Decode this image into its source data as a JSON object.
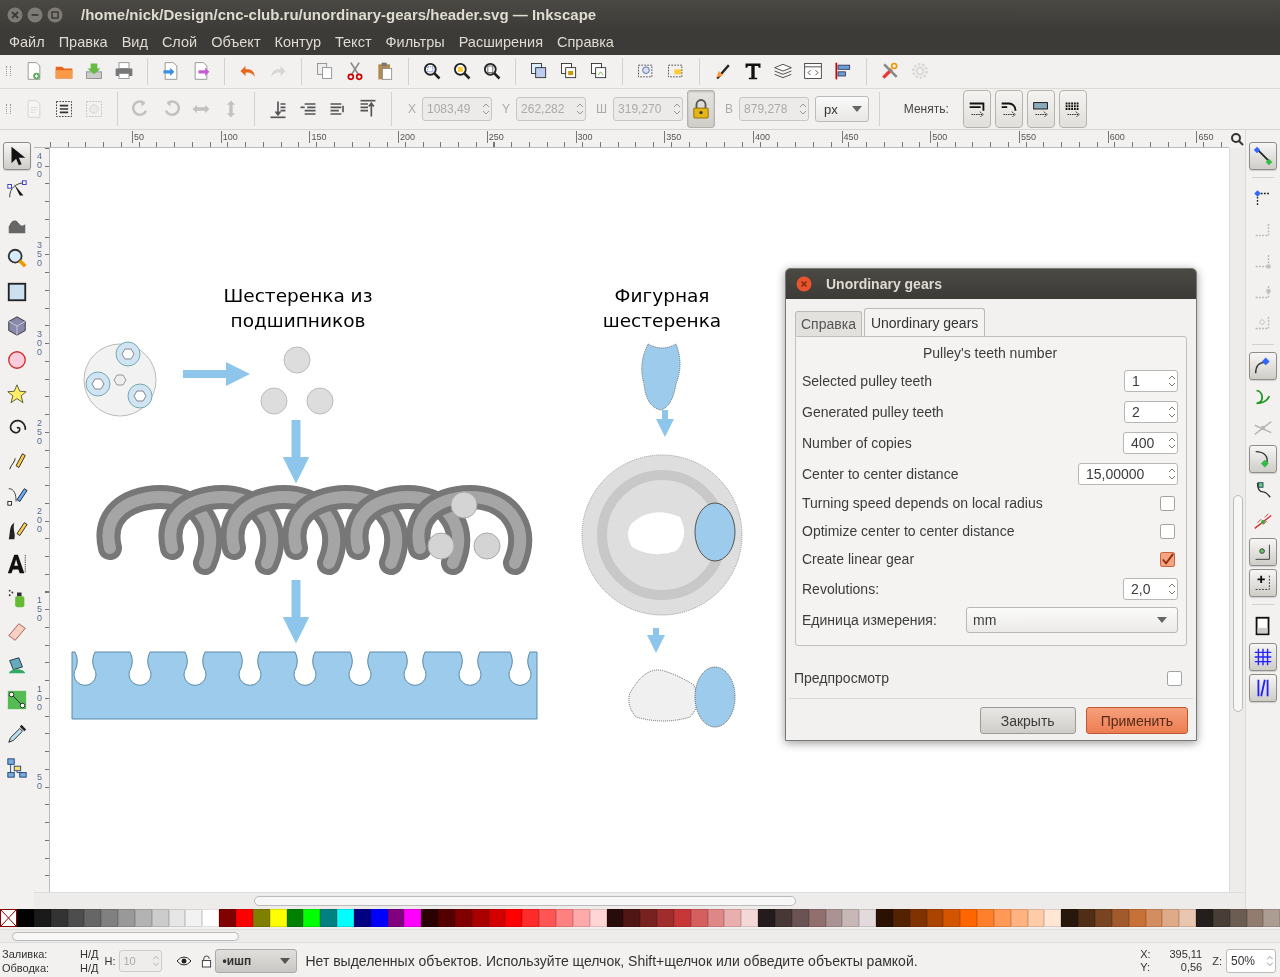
{
  "window": {
    "title": "/home/nick/Design/cnc-club.ru/unordinary-gears/header.svg — Inkscape"
  },
  "menu": [
    "Файл",
    "Правка",
    "Вид",
    "Слой",
    "Объект",
    "Контур",
    "Текст",
    "Фильтры",
    "Расширения",
    "Справка"
  ],
  "main_toolbar": [
    {
      "kind": "new",
      "disabled": false
    },
    {
      "kind": "open",
      "disabled": false
    },
    {
      "kind": "save",
      "disabled": false
    },
    {
      "kind": "print",
      "disabled": false
    },
    {
      "kind": "sep"
    },
    {
      "kind": "import",
      "disabled": false
    },
    {
      "kind": "export",
      "disabled": false
    },
    {
      "kind": "sep"
    },
    {
      "kind": "undo",
      "disabled": false
    },
    {
      "kind": "redo",
      "disabled": true
    },
    {
      "kind": "sep"
    },
    {
      "kind": "copy",
      "disabled": false
    },
    {
      "kind": "cut",
      "disabled": false
    },
    {
      "kind": "paste",
      "disabled": false
    },
    {
      "kind": "sep"
    },
    {
      "kind": "zoomsel",
      "disabled": false
    },
    {
      "kind": "zoomdraw",
      "disabled": false
    },
    {
      "kind": "zoompage",
      "disabled": false
    },
    {
      "kind": "sep"
    },
    {
      "kind": "duplicate",
      "disabled": false
    },
    {
      "kind": "clone",
      "disabled": false
    },
    {
      "kind": "unlink",
      "disabled": false
    },
    {
      "kind": "sep"
    },
    {
      "kind": "group",
      "disabled": false
    },
    {
      "kind": "ungroup",
      "disabled": false
    },
    {
      "kind": "sep"
    },
    {
      "kind": "fillstroke",
      "disabled": false
    },
    {
      "kind": "text",
      "disabled": false
    },
    {
      "kind": "layers",
      "disabled": false
    },
    {
      "kind": "xml",
      "disabled": false
    },
    {
      "kind": "align",
      "disabled": false
    },
    {
      "kind": "sep"
    },
    {
      "kind": "prefs",
      "disabled": false
    },
    {
      "kind": "gear",
      "disabled": true
    }
  ],
  "select_toolbar": {
    "buttons": [
      {
        "kind": "page",
        "disabled": true
      },
      {
        "kind": "selectall",
        "disabled": false
      },
      {
        "kind": "deselect",
        "disabled": true
      },
      {
        "kind": "sep"
      },
      {
        "kind": "rotccw",
        "disabled": true
      },
      {
        "kind": "rotcw",
        "disabled": true
      },
      {
        "kind": "fliph",
        "disabled": true
      },
      {
        "kind": "flipv",
        "disabled": true
      },
      {
        "kind": "sep"
      },
      {
        "kind": "bottom",
        "disabled": false
      },
      {
        "kind": "lower",
        "disabled": false
      },
      {
        "kind": "raise",
        "disabled": false
      },
      {
        "kind": "top",
        "disabled": false
      }
    ],
    "fields": [
      {
        "label": "X",
        "value": "1083,49",
        "disabled": true
      },
      {
        "label": "Y",
        "value": "262,282",
        "disabled": true
      },
      {
        "label": "Ш",
        "value": "319,270",
        "disabled": true
      }
    ],
    "lock": {
      "on": true
    },
    "height_field": {
      "label": "В",
      "value": "879,278",
      "disabled": true
    },
    "unit": "px",
    "change_label": "Менять:",
    "change_buttons": [
      {
        "kind": "scalestroke"
      },
      {
        "kind": "scalecorners"
      },
      {
        "kind": "scalegradient"
      },
      {
        "kind": "scalepattern"
      }
    ]
  },
  "rulers": {
    "horizontal": [
      "50",
      "100",
      "150",
      "200",
      "250",
      "300",
      "350",
      "400",
      "450",
      "500",
      "550",
      "600",
      "650"
    ],
    "vertical": [
      "400",
      "350",
      "300",
      "250",
      "200",
      "150",
      "100",
      "50"
    ]
  },
  "tools": [
    {
      "kind": "selector",
      "selected": true
    },
    {
      "kind": "node",
      "selected": false
    },
    {
      "kind": "tweak",
      "selected": false
    },
    {
      "kind": "zoom",
      "selected": false
    },
    {
      "kind": "rect",
      "selected": false
    },
    {
      "kind": "box3d",
      "selected": false
    },
    {
      "kind": "ellipse",
      "selected": false
    },
    {
      "kind": "star",
      "selected": false
    },
    {
      "kind": "spiral",
      "selected": false
    },
    {
      "kind": "pencil",
      "selected": false
    },
    {
      "kind": "pen",
      "selected": false
    },
    {
      "kind": "calligraphy",
      "selected": false
    },
    {
      "kind": "textt",
      "selected": false
    },
    {
      "kind": "spray",
      "selected": false
    },
    {
      "kind": "eraser",
      "selected": false
    },
    {
      "kind": "bucket",
      "selected": false
    },
    {
      "kind": "gradient",
      "selected": false
    },
    {
      "kind": "dropper",
      "selected": false
    },
    {
      "kind": "connector",
      "selected": false
    }
  ],
  "canvas": {
    "headings": [
      "Шестеренка из подшипников",
      "Фигурная шестеренка"
    ]
  },
  "dialog": {
    "title": "Unordinary gears",
    "tabs": [
      {
        "label": "Справка",
        "selected": false
      },
      {
        "label": "Unordinary gears",
        "selected": true
      }
    ],
    "heading": "Pulley's teeth number",
    "rows": [
      {
        "kind": "spin",
        "label": "Selected pulley teeth",
        "value": "1"
      },
      {
        "kind": "spin",
        "label": "Generated pulley teeth",
        "value": "2"
      },
      {
        "kind": "spin",
        "label": "Number of copies",
        "value": "400"
      },
      {
        "kind": "spin",
        "label": "Center to center distance",
        "value": "15,00000"
      },
      {
        "kind": "check",
        "label": "Turning speed depends on local radius",
        "checked": false
      },
      {
        "kind": "check",
        "label": "Optimize center to center distance",
        "checked": false
      },
      {
        "kind": "check",
        "label": "Create linear gear",
        "checked": true
      },
      {
        "kind": "spin",
        "label": "Revolutions:",
        "value": "2,0"
      },
      {
        "kind": "select",
        "label": "Единица измерения:",
        "value": "mm"
      }
    ],
    "preview": {
      "label": "Предпросмотр",
      "checked": false
    },
    "buttons": [
      {
        "label": "Закрыть",
        "kind": "secondary"
      },
      {
        "label": "Применить",
        "kind": "primary"
      }
    ]
  },
  "snaps": [
    {
      "kind": "snap",
      "on": true,
      "disabled": false
    },
    {
      "kind": "sep"
    },
    {
      "kind": "bbox",
      "on": false,
      "disabled": false
    },
    {
      "kind": "bboxedge",
      "on": false,
      "disabled": true
    },
    {
      "kind": "bboxcorner",
      "on": false,
      "disabled": true
    },
    {
      "kind": "bboxmid",
      "on": false,
      "disabled": true
    },
    {
      "kind": "bboxcenter",
      "on": false,
      "disabled": true
    },
    {
      "kind": "sep"
    },
    {
      "kind": "nodes",
      "on": true,
      "disabled": false
    },
    {
      "kind": "path",
      "on": false,
      "disabled": false
    },
    {
      "kind": "intersect",
      "on": false,
      "disabled": true
    },
    {
      "kind": "cusp",
      "on": true,
      "disabled": false
    },
    {
      "kind": "smooth",
      "on": false,
      "disabled": false
    },
    {
      "kind": "midpoint",
      "on": false,
      "disabled": false
    },
    {
      "kind": "objcenter",
      "on": true,
      "disabled": false
    },
    {
      "kind": "rotcenter",
      "on": true,
      "disabled": false
    },
    {
      "kind": "sep"
    },
    {
      "kind": "pageborder",
      "on": false,
      "disabled": false
    },
    {
      "kind": "grid",
      "on": true,
      "disabled": false
    },
    {
      "kind": "guide",
      "on": true,
      "disabled": false
    }
  ],
  "palette": [
    {
      "color": "#000000"
    },
    {
      "color": "#1a1a1a"
    },
    {
      "color": "#333333"
    },
    {
      "color": "#4d4d4d"
    },
    {
      "color": "#666666"
    },
    {
      "color": "#808080"
    },
    {
      "color": "#999999"
    },
    {
      "color": "#b3b3b3"
    },
    {
      "color": "#cccccc"
    },
    {
      "color": "#e6e6e6"
    },
    {
      "color": "#f2f2f2"
    },
    {
      "color": "#ffffff"
    },
    {
      "color": "#800000"
    },
    {
      "color": "#ff0000"
    },
    {
      "color": "#808000"
    },
    {
      "color": "#ffff00"
    },
    {
      "color": "#008000"
    },
    {
      "color": "#00ff00"
    },
    {
      "color": "#008080"
    },
    {
      "color": "#00ffff"
    },
    {
      "color": "#000080"
    },
    {
      "color": "#0000ff"
    },
    {
      "color": "#800080"
    },
    {
      "color": "#ff00ff"
    },
    {
      "color": "#2b0000"
    },
    {
      "color": "#550000"
    },
    {
      "color": "#800001"
    },
    {
      "color": "#aa0000"
    },
    {
      "color": "#d40000"
    },
    {
      "color": "#ff0001"
    },
    {
      "color": "#ff2a2a"
    },
    {
      "color": "#ff5555"
    },
    {
      "color": "#ff8080"
    },
    {
      "color": "#ffaaaa"
    },
    {
      "color": "#ffd5d5"
    },
    {
      "color": "#280b0b"
    },
    {
      "color": "#501616"
    },
    {
      "color": "#782121"
    },
    {
      "color": "#a02c2c"
    },
    {
      "color": "#c83737"
    },
    {
      "color": "#d35f5f"
    },
    {
      "color": "#de8787"
    },
    {
      "color": "#e9afaf"
    },
    {
      "color": "#f4d7d7"
    },
    {
      "color": "#241c1c"
    },
    {
      "color": "#483737"
    },
    {
      "color": "#6c5353"
    },
    {
      "color": "#916f6f"
    },
    {
      "color": "#ac9393"
    },
    {
      "color": "#c8b7b7"
    },
    {
      "color": "#e3dbdb"
    },
    {
      "color": "#2b1100"
    },
    {
      "color": "#552200"
    },
    {
      "color": "#803300"
    },
    {
      "color": "#aa4400"
    },
    {
      "color": "#d45500"
    },
    {
      "color": "#ff6600"
    },
    {
      "color": "#ff7f2a"
    },
    {
      "color": "#ff9955"
    },
    {
      "color": "#ffb380"
    },
    {
      "color": "#ffccaa"
    },
    {
      "color": "#ffe6d5"
    },
    {
      "color": "#28170b"
    },
    {
      "color": "#502d16"
    },
    {
      "color": "#784421"
    },
    {
      "color": "#a05a2c"
    },
    {
      "color": "#c87137"
    },
    {
      "color": "#d38d5f"
    },
    {
      "color": "#deaa87"
    },
    {
      "color": "#e9c6af"
    },
    {
      "color": "#241f1c"
    },
    {
      "color": "#483e37"
    },
    {
      "color": "#6c5d53"
    },
    {
      "color": "#917c6f"
    },
    {
      "color": "#ac9d93"
    }
  ],
  "status": {
    "fill_label": "Заливка:",
    "fill_value": "Н/Д",
    "stroke_label": "Обводка:",
    "stroke_value": "Н/Д",
    "stroke_width_label": "Н:",
    "stroke_width_value": "10",
    "layer": "•ишп",
    "message": "Нет выделенных объектов. Используйте щелчок, Shift+щелчок или обведите объекты рамкой.",
    "x_label": "X:",
    "x_value": "395,11",
    "y_label": "Y:",
    "y_value": "0,56",
    "zoom_label": "Z:",
    "zoom_value": "50%"
  }
}
